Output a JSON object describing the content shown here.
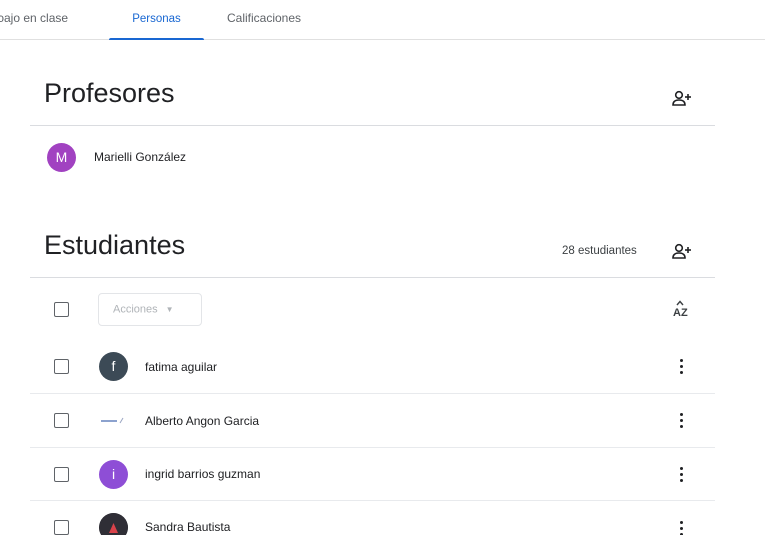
{
  "tabs": [
    {
      "label": "ɔajo en clase",
      "active": false
    },
    {
      "label": "Personas",
      "active": true
    },
    {
      "label": "Calificaciones",
      "active": false
    }
  ],
  "teachers_section": {
    "title": "Profesores",
    "add_icon": "add-person-icon",
    "teachers": [
      {
        "initial": "M",
        "name": "Marielli González",
        "avatar_color": "#a142c1"
      }
    ]
  },
  "students_section": {
    "title": "Estudiantes",
    "count_label": "28 estudiantes",
    "add_icon": "add-person-icon",
    "actions_label": "Acciones",
    "sort_icon": "sort-az-icon",
    "students": [
      {
        "name": "fatima aguilar",
        "initial": "f",
        "avatar_type": "letter",
        "avatar_color": "#3c4a56"
      },
      {
        "name": "Alberto Angon Garcia",
        "avatar_type": "logo"
      },
      {
        "name": "ingrid barrios guzman",
        "initial": "i",
        "avatar_type": "letter",
        "avatar_color": "#8e4ed6"
      },
      {
        "name": "Sandra Bautista",
        "avatar_type": "photo"
      }
    ]
  },
  "colors": {
    "accent": "#1967d2",
    "divider": "#dadce0"
  }
}
